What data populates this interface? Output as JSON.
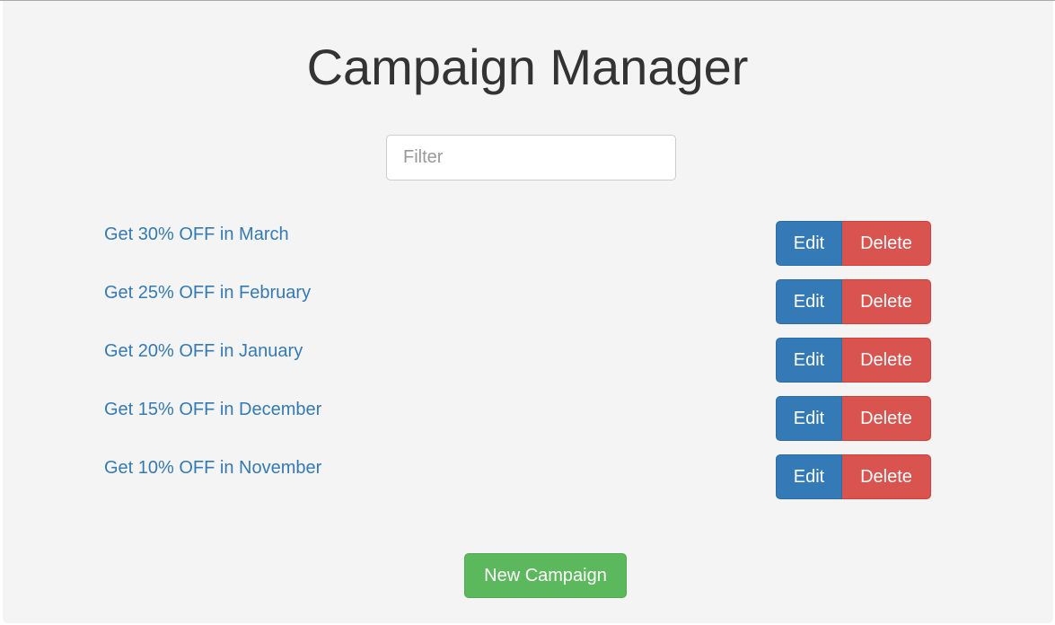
{
  "page": {
    "title": "Campaign Manager"
  },
  "filter": {
    "placeholder": "Filter",
    "value": ""
  },
  "campaigns": [
    {
      "name": "Get 30% OFF in March"
    },
    {
      "name": "Get 25% OFF in February"
    },
    {
      "name": "Get 20% OFF in January"
    },
    {
      "name": "Get 15% OFF in December"
    },
    {
      "name": "Get 10% OFF in November"
    }
  ],
  "actions": {
    "edit_label": "Edit",
    "delete_label": "Delete",
    "new_campaign_label": "New Campaign"
  },
  "colors": {
    "link": "#337ab7",
    "edit": "#337ab7",
    "delete": "#d9534f",
    "new": "#5cb85c",
    "panel_background": "#f4f4f4"
  }
}
